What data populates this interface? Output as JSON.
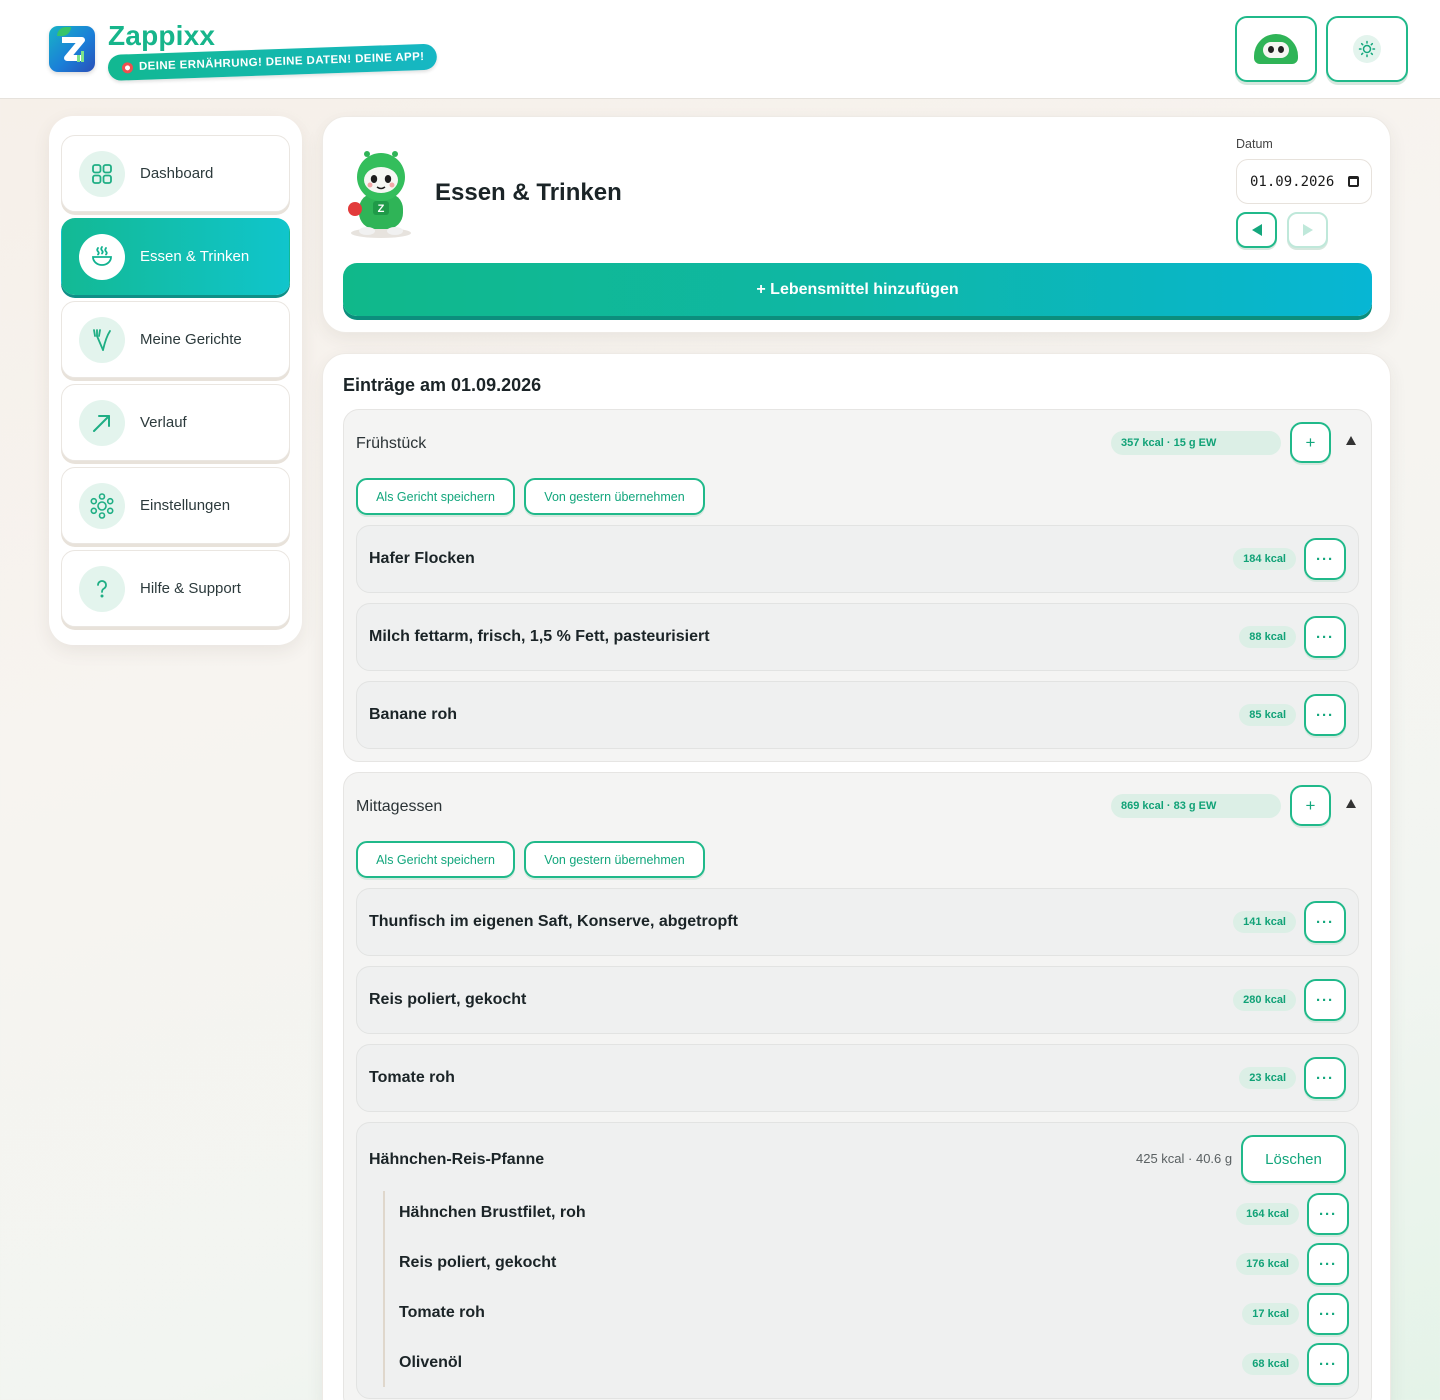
{
  "app": {
    "name": "Zappixx",
    "tagline": "DEINE ERNÄHRUNG! DEINE DATEN! DEINE APP!"
  },
  "sidebar": {
    "items": [
      {
        "label": "Dashboard",
        "icon": "grid-icon",
        "active": false
      },
      {
        "label": "Essen & Trinken",
        "icon": "bowl-icon",
        "active": true
      },
      {
        "label": "Meine Gerichte",
        "icon": "fork-icon",
        "active": false
      },
      {
        "label": "Verlauf",
        "icon": "arrow-up-right-icon",
        "active": false
      },
      {
        "label": "Einstellungen",
        "icon": "settings-icon",
        "active": false
      },
      {
        "label": "Hilfe & Support",
        "icon": "help-icon",
        "active": false
      }
    ]
  },
  "page": {
    "title": "Essen & Trinken",
    "date_label": "Datum",
    "date_value": "01.09.2026",
    "add_food_label": "+ Lebensmittel hinzufügen",
    "entries_title": "Einträge am 01.09.2026"
  },
  "meals": [
    {
      "name": "Frühstück",
      "summary": "357 kcal · 15 g EW",
      "add_label": "+",
      "save_dish_label": "Als Gericht speichern",
      "from_yesterday_label": "Von gestern übernehmen",
      "foods": [
        {
          "name": "Hafer Flocken",
          "kcal": "184 kcal"
        },
        {
          "name": "Milch fettarm, frisch, 1,5 % Fett, pasteurisiert",
          "kcal": "88 kcal"
        },
        {
          "name": "Banane roh",
          "kcal": "85 kcal"
        }
      ]
    },
    {
      "name": "Mittagessen",
      "summary": "869 kcal · 83 g EW",
      "add_label": "+",
      "save_dish_label": "Als Gericht speichern",
      "from_yesterday_label": "Von gestern übernehmen",
      "foods": [
        {
          "name": "Thunfisch im eigenen Saft, Konserve, abgetropft",
          "kcal": "141 kcal"
        },
        {
          "name": "Reis poliert, gekocht",
          "kcal": "280 kcal"
        },
        {
          "name": "Tomate roh",
          "kcal": "23 kcal"
        }
      ],
      "dish": {
        "name": "Hähnchen-Reis-Pfanne",
        "meta": "425 kcal · 40.6 g",
        "delete_label": "Löschen",
        "items": [
          {
            "name": "Hähnchen Brustfilet, roh",
            "kcal": "164 kcal"
          },
          {
            "name": "Reis poliert, gekocht",
            "kcal": "176 kcal"
          },
          {
            "name": "Tomate roh",
            "kcal": "17 kcal"
          },
          {
            "name": "Olivenöl",
            "kcal": "68 kcal"
          }
        ]
      }
    }
  ],
  "common": {
    "more_label": "···"
  },
  "colors": {
    "accent": "#20b98a",
    "accent_dark": "#12a67c",
    "gradient_start": "#10b88a",
    "gradient_end": "#07b6d4",
    "pill_bg": "#dcefe6"
  }
}
